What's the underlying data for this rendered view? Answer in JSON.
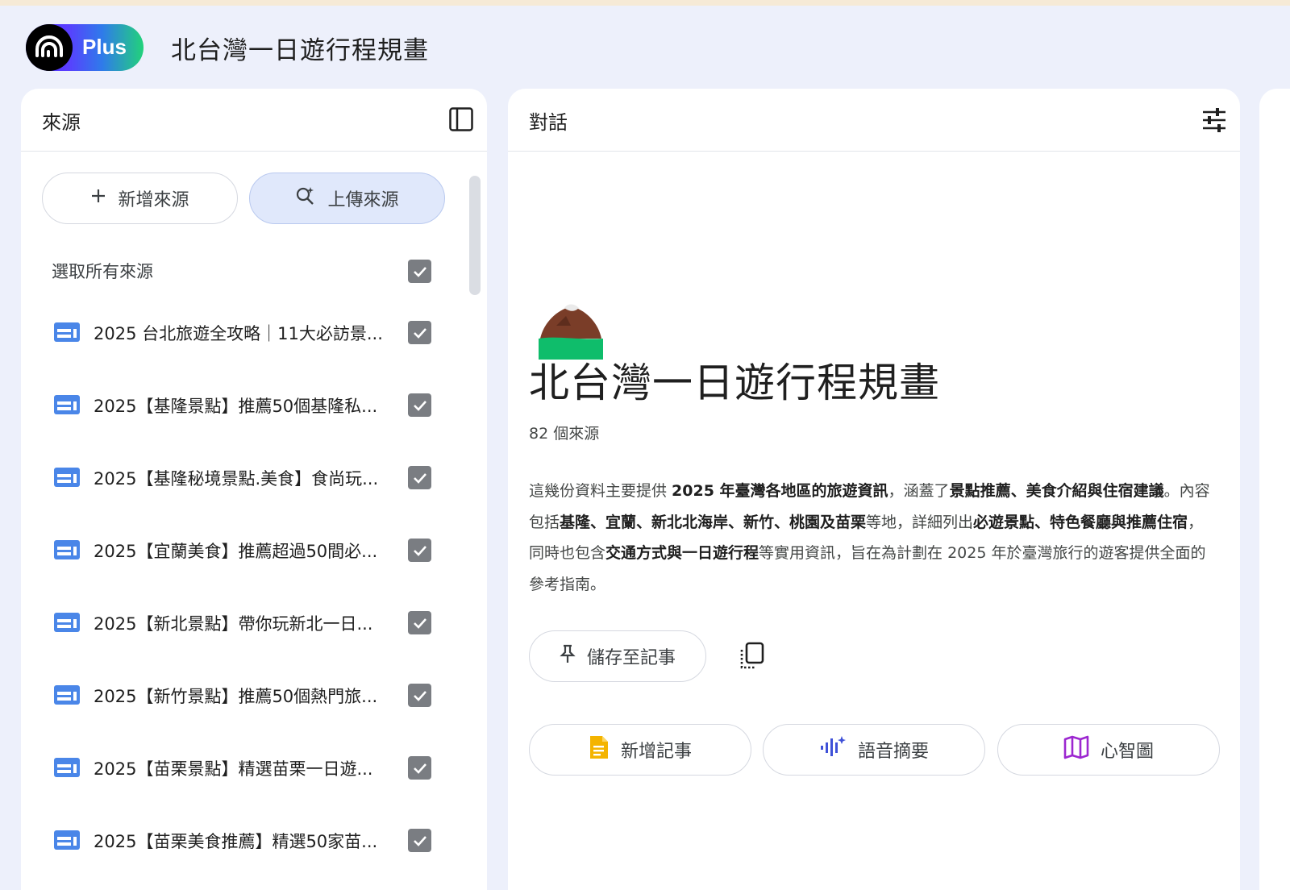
{
  "app": {
    "logo_badge": "Plus",
    "title": "北台灣一日遊行程規畫"
  },
  "sources_panel": {
    "title": "來源",
    "add_label": "新增來源",
    "upload_label": "上傳來源",
    "select_all_label": "選取所有來源",
    "items": [
      {
        "label": "2025 台北旅遊全攻略｜11大必訪景...",
        "icon": "doc-icon",
        "checked": true
      },
      {
        "label": "2025【基隆景點】推薦50個基隆私...",
        "icon": "doc-icon",
        "checked": true
      },
      {
        "label": "2025【基隆秘境景點.美食】食尚玩...",
        "icon": "doc-icon",
        "checked": true
      },
      {
        "label": "2025【宜蘭美食】推薦超過50間必...",
        "icon": "doc-icon",
        "checked": true
      },
      {
        "label": "2025【新北景點】帶你玩新北一日...",
        "icon": "doc-icon",
        "checked": true
      },
      {
        "label": "2025【新竹景點】推薦50個熱門旅...",
        "icon": "doc-icon",
        "checked": true
      },
      {
        "label": "2025【苗栗景點】精選苗栗一日遊...",
        "icon": "doc-icon",
        "checked": true
      },
      {
        "label": "2025【苗栗美食推薦】精選50家苗...",
        "icon": "doc-icon",
        "checked": true
      }
    ]
  },
  "chat_panel": {
    "title": "對話",
    "notebook_title": "北台灣一日遊行程規畫",
    "source_count": "82 個來源",
    "summary": {
      "p1": "這幾份資料主要提供 ",
      "b1": "2025 年臺灣各地區的旅遊資訊",
      "p2": "，涵蓋了",
      "b2": "景點推薦、美食介紹與住宿建議",
      "p3": "。內容包括",
      "b3": "基隆、宜蘭、新北北海岸、新竹、桃園及苗栗",
      "p4": "等地，詳細列出",
      "b4": "必遊景點、特色餐廳與推薦住宿",
      "p5": "，同時也包含",
      "b5": "交通方式與一日遊行程",
      "p6": "等實用資訊，旨在為計劃在 2025 年於臺灣旅行的遊客提供全面的參考指南。"
    },
    "save_note_label": "儲存至記事",
    "actions": [
      {
        "label": "新增記事",
        "icon": "note-icon",
        "color": "#f4b400"
      },
      {
        "label": "語音摘要",
        "icon": "audio-icon",
        "color": "#3f51d8"
      },
      {
        "label": "心智圖",
        "icon": "mind-map-icon",
        "color": "#9c27d0"
      }
    ]
  },
  "colors": {
    "background": "#edf0fb",
    "upload_button_bg": "#e0e8fb",
    "checkbox": "#7a7d82",
    "doc_icon": "#4a86e8"
  }
}
